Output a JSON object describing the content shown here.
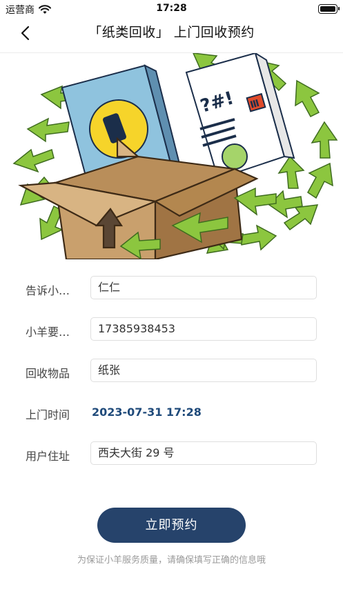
{
  "status_bar": {
    "carrier": "运营商",
    "time": "17:28"
  },
  "navbar": {
    "title": "「纸类回收」 上门回收预约"
  },
  "banner": {
    "book_label": "Ⅲ",
    "newspaper_label": "?#!"
  },
  "form": {
    "name": {
      "label": "告诉小…",
      "value": "仁仁"
    },
    "phone": {
      "label": "小羊要…",
      "value": "17385938453"
    },
    "item": {
      "label": "回收物品",
      "value": "纸张"
    },
    "time": {
      "label": "上门时间",
      "value": "2023-07-31 17:28"
    },
    "address": {
      "label": "用户住址",
      "value": "西夫大街 29 号"
    }
  },
  "submit_label": "立即预约",
  "hint": "为保证小羊服务质量，请确保填写正确的信息哦",
  "colors": {
    "accent": "#26436b",
    "time_text": "#1f4a7a",
    "arrow_green": "#8cc63f"
  }
}
